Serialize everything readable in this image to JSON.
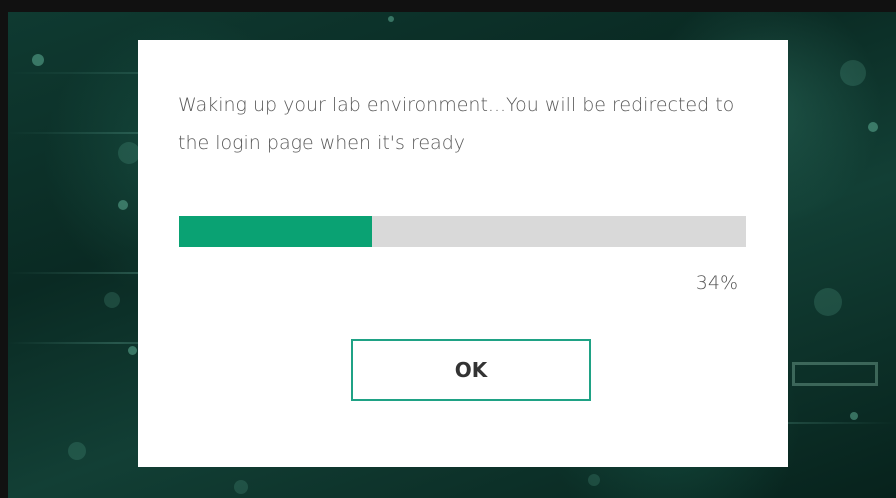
{
  "dialog": {
    "message": "Waking up your lab environment...You will be redirected to the login page when it's ready",
    "progress": {
      "percent_value": 34,
      "percent_label": "34%",
      "fill_color": "#0aa273",
      "track_color": "#d9d9d9"
    },
    "ok_label": "OK",
    "button_border_color": "#1fa285"
  },
  "background": {
    "description_color": "#0f3a31"
  }
}
